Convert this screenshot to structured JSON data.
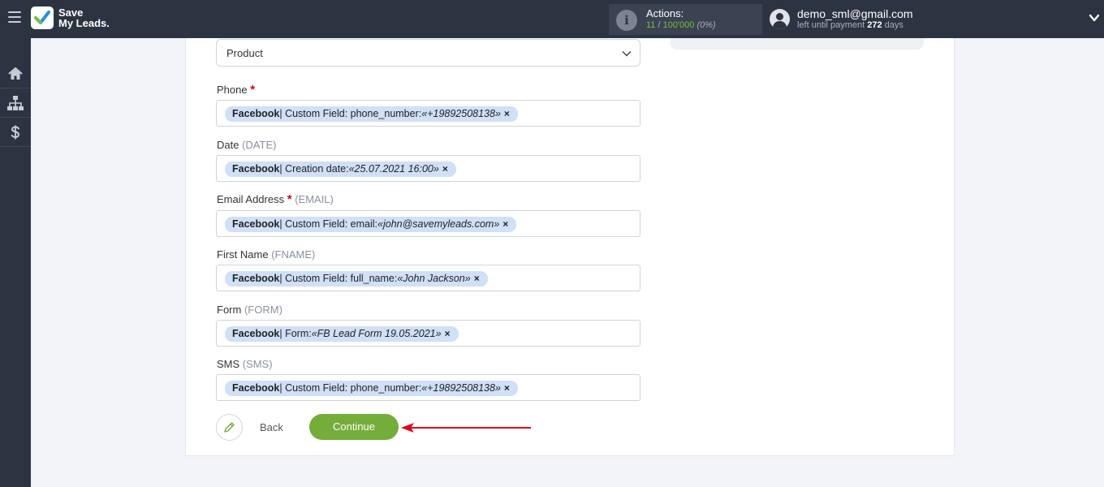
{
  "header": {
    "logo_line1": "Save",
    "logo_line2": "My Leads.",
    "actions_label": "Actions:",
    "actions_used": "11",
    "actions_sep": " / ",
    "actions_total": "100'000",
    "actions_pct": "(0%)",
    "user_email": "demo_sml@gmail.com",
    "payment_prefix": "left until payment ",
    "payment_days": "272",
    "payment_suffix": " days"
  },
  "sidebar": {
    "items": [
      {
        "icon": "home-icon"
      },
      {
        "icon": "sitemap-icon"
      },
      {
        "icon": "dollar-icon"
      }
    ]
  },
  "form": {
    "select_value": "Product",
    "fields": [
      {
        "label": "Phone",
        "required": true,
        "code": "",
        "tag_source": "Facebook",
        "tag_text": " | Custom Field: phone_number: ",
        "tag_value": "«+19892508138»"
      },
      {
        "label": "Date",
        "required": false,
        "code": "(DATE)",
        "tag_source": "Facebook",
        "tag_text": " | Creation date: ",
        "tag_value": "«25.07.2021 16:00»"
      },
      {
        "label": "Email Address",
        "required": true,
        "code": "(EMAIL)",
        "tag_source": "Facebook",
        "tag_text": " | Custom Field: email: ",
        "tag_value": "«john@savemyleads.com»"
      },
      {
        "label": "First Name",
        "required": false,
        "code": "(FNAME)",
        "tag_source": "Facebook",
        "tag_text": " | Custom Field: full_name: ",
        "tag_value": "«John Jackson»"
      },
      {
        "label": "Form",
        "required": false,
        "code": "(FORM)",
        "tag_source": "Facebook",
        "tag_text": " | Form: ",
        "tag_value": "«FB Lead Form 19.05.2021»"
      },
      {
        "label": "SMS",
        "required": false,
        "code": "(SMS)",
        "tag_source": "Facebook",
        "tag_text": " | Custom Field: phone_number: ",
        "tag_value": "«+19892508138»"
      }
    ],
    "required_mark": "*",
    "remove_glyph": "×",
    "back_label": "Back",
    "continue_label": "Continue"
  },
  "colors": {
    "topbar": "#2c3442",
    "accent_green": "#74ad3a",
    "tag_bg": "#cfe0f7",
    "required": "#d0021b",
    "arrow": "#e0001b"
  }
}
